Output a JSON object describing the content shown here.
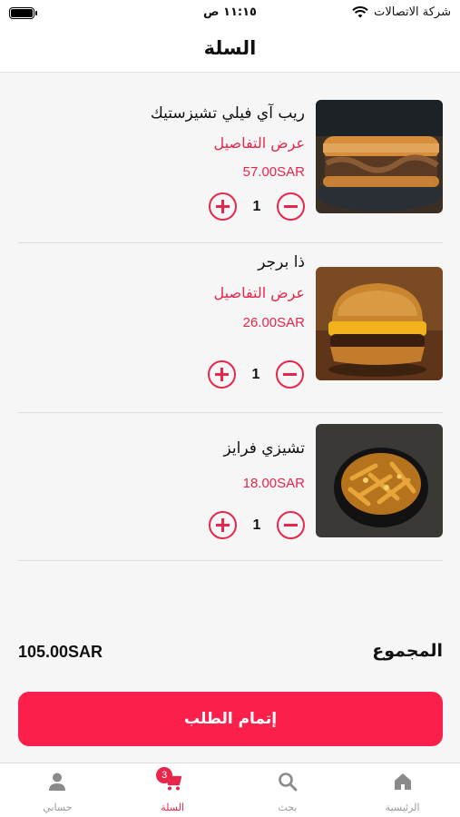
{
  "status_bar": {
    "carrier": "شركة الاتصالات",
    "time": "١١:١٥ ص"
  },
  "header": {
    "title": "السلة"
  },
  "cart": {
    "details_label": "عرض التفاصيل",
    "items": [
      {
        "name": "ريب آي فيلي تشيزستيك",
        "price": "57.00SAR",
        "quantity": "1",
        "image": "cheesesteak-sandwich"
      },
      {
        "name": "ذا برجر",
        "price": "26.00SAR",
        "quantity": "1",
        "image": "cheeseburger"
      },
      {
        "name": "تشيزي فرايز",
        "price": "18.00SAR",
        "quantity": "1",
        "image": "cheesy-fries"
      }
    ]
  },
  "summary": {
    "total_label": "المجموع",
    "total_value": "105.00SAR"
  },
  "checkout": {
    "label": "إتمام الطلب"
  },
  "tabbar": {
    "tabs": [
      {
        "label": "الرئيسية",
        "icon": "home-icon"
      },
      {
        "label": "بحث",
        "icon": "search-icon"
      },
      {
        "label": "السلة",
        "icon": "cart-icon",
        "badge": "3"
      },
      {
        "label": "حسابي",
        "icon": "user-icon"
      }
    ]
  },
  "colors": {
    "accent": "#e8264c",
    "button": "#fb1f4b"
  }
}
